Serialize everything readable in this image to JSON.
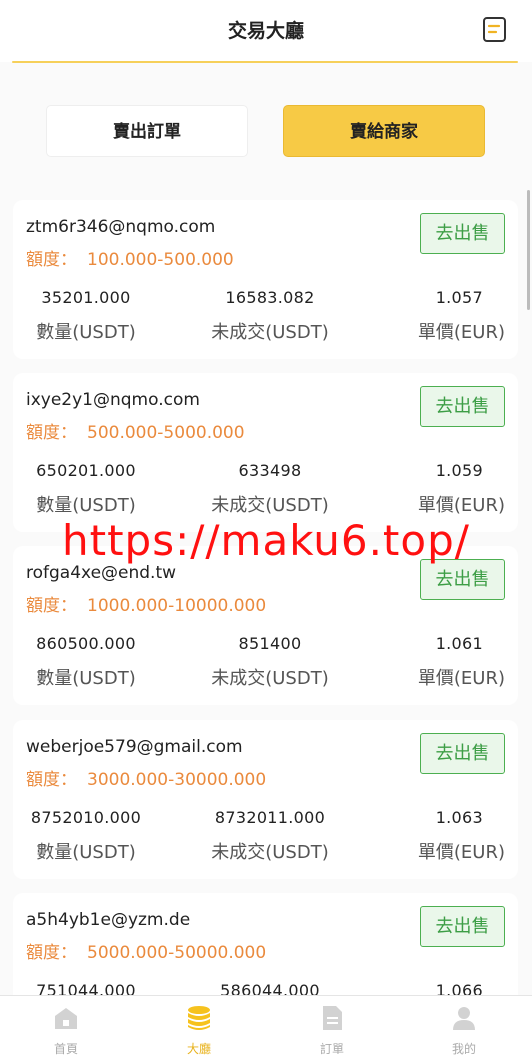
{
  "header": {
    "title": "交易大廳",
    "icon": "order-list-icon",
    "accent_color": "#f6d05a"
  },
  "tabs": [
    {
      "label": "賣出訂單",
      "active": false
    },
    {
      "label": "賣給商家",
      "active": true
    }
  ],
  "stat_labels": {
    "quantity": "數量(USDT)",
    "pending": "未成交(USDT)",
    "price": "單價(EUR)"
  },
  "limit_label": "額度：",
  "sell_button_label": "去出售",
  "merchants": [
    {
      "email": "ztm6r346@nqmo.com",
      "limit": "100.000-500.000",
      "quantity": "35201.000",
      "pending": "16583.082",
      "price": "1.057"
    },
    {
      "email": "ixye2y1@nqmo.com",
      "limit": "500.000-5000.000",
      "quantity": "650201.000",
      "pending": "633498",
      "price": "1.059"
    },
    {
      "email": "rofga4xe@end.tw",
      "limit": "1000.000-10000.000",
      "quantity": "860500.000",
      "pending": "851400",
      "price": "1.061"
    },
    {
      "email": "weberjoe579@gmail.com",
      "limit": "3000.000-30000.000",
      "quantity": "8752010.000",
      "pending": "8732011.000",
      "price": "1.063"
    },
    {
      "email": "a5h4yb1e@yzm.de",
      "limit": "5000.000-50000.000",
      "quantity": "751044.000",
      "pending": "586044.000",
      "price": "1.066"
    }
  ],
  "watermark": "https://maku6.top/",
  "bottom_nav": [
    {
      "label": "首頁",
      "icon": "home-icon",
      "active": false
    },
    {
      "label": "大廳",
      "icon": "coins-icon",
      "active": true
    },
    {
      "label": "訂單",
      "icon": "document-icon",
      "active": false
    },
    {
      "label": "我的",
      "icon": "user-icon",
      "active": false
    }
  ],
  "colors": {
    "active_tab": "#f7ca45",
    "limit_text": "#ea8a3d",
    "sell_button": "#3d9e46",
    "nav_active": "#e8b21b",
    "watermark": "#ff1010"
  }
}
